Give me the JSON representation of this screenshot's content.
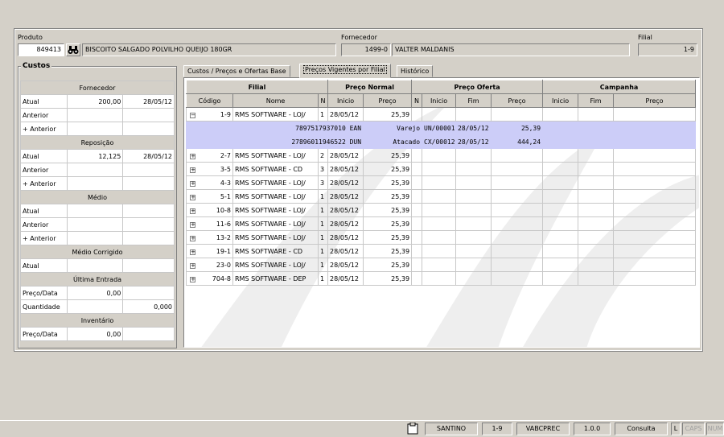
{
  "header": {
    "produto_label": "Produto",
    "produto_codigo": "849413",
    "produto_nome": "BISCOITO SALGADO POLVILHO QUEIJO 180GR",
    "fornecedor_label": "Fornecedor",
    "fornecedor_codigo": "1499-0",
    "fornecedor_nome": "VALTER MALDANIS",
    "filial_label": "Filial",
    "filial_value": "1-9"
  },
  "custos": {
    "title": "Custos",
    "sections": [
      {
        "title": "Fornecedor",
        "rows": [
          {
            "label": "Atual",
            "value": "200,00",
            "date": "28/05/12"
          },
          {
            "label": "Anterior",
            "value": "",
            "date": ""
          },
          {
            "label": "+ Anterior",
            "value": "",
            "date": ""
          }
        ]
      },
      {
        "title": "Reposição",
        "rows": [
          {
            "label": "Atual",
            "value": "12,125",
            "date": "28/05/12"
          },
          {
            "label": "Anterior",
            "value": "",
            "date": ""
          },
          {
            "label": "+ Anterior",
            "value": "",
            "date": ""
          }
        ]
      },
      {
        "title": "Médio",
        "rows": [
          {
            "label": "Atual",
            "value": "",
            "date": ""
          },
          {
            "label": "Anterior",
            "value": "",
            "date": ""
          },
          {
            "label": "+ Anterior",
            "value": "",
            "date": ""
          }
        ]
      },
      {
        "title": "Médio Corrigido",
        "rows": [
          {
            "label": "Atual",
            "value": "",
            "date": ""
          }
        ]
      },
      {
        "title": "Última Entrada",
        "rows": [
          {
            "label": "Preço/Data",
            "value": "0,00",
            "date": ""
          },
          {
            "label": "Quantidade",
            "value": "",
            "date": "0,000"
          }
        ]
      },
      {
        "title": "Inventário",
        "rows": [
          {
            "label": "Preço/Data",
            "value": "0,00",
            "date": ""
          }
        ]
      }
    ]
  },
  "tabs": [
    {
      "label": "Custos / Preços e Ofertas Base",
      "active": false
    },
    {
      "label": "Preços Vigentes por Filial",
      "active": true
    },
    {
      "label": "Histórico",
      "active": false
    }
  ],
  "grid": {
    "groups": [
      "Filial",
      "Preço Normal",
      "Preço Oferta",
      "Campanha"
    ],
    "columns": [
      "Código",
      "Nome",
      "N",
      "Inicio",
      "Preço",
      "N",
      "Inicio",
      "Fim",
      "Preço",
      "Inicio",
      "Fim",
      "Preço"
    ],
    "rows": [
      {
        "expander": "−",
        "codigo": "1-9",
        "nome": "RMS SOFTWARE - LOJ/",
        "n": "1",
        "inicio": "28/05/12",
        "preco": "25,39",
        "subrows": [
          {
            "ean": "7897517937010 EAN",
            "tipo": "Varejo",
            "emb": "UN/00001",
            "data": "28/05/12",
            "preco": "25,39"
          },
          {
            "ean": "27896011946522 DUN",
            "tipo": "Atacado",
            "emb": "CX/00012",
            "data": "28/05/12",
            "preco": "444,24"
          }
        ]
      },
      {
        "expander": "+",
        "codigo": "2-7",
        "nome": "RMS SOFTWARE - LOJ/",
        "n": "2",
        "inicio": "28/05/12",
        "preco": "25,39"
      },
      {
        "expander": "+",
        "codigo": "3-5",
        "nome": "RMS SOFTWARE - CD",
        "n": "3",
        "inicio": "28/05/12",
        "preco": "25,39"
      },
      {
        "expander": "+",
        "codigo": "4-3",
        "nome": "RMS SOFTWARE - LOJ/",
        "n": "3",
        "inicio": "28/05/12",
        "preco": "25,39"
      },
      {
        "expander": "+",
        "codigo": "5-1",
        "nome": "RMS SOFTWARE - LOJ/",
        "n": "1",
        "inicio": "28/05/12",
        "preco": "25,39"
      },
      {
        "expander": "+",
        "codigo": "10-8",
        "nome": "RMS SOFTWARE - LOJ/",
        "n": "1",
        "inicio": "28/05/12",
        "preco": "25,39"
      },
      {
        "expander": "+",
        "codigo": "11-6",
        "nome": "RMS SOFTWARE - LOJ/",
        "n": "1",
        "inicio": "28/05/12",
        "preco": "25,39"
      },
      {
        "expander": "+",
        "codigo": "13-2",
        "nome": "RMS SOFTWARE - LOJ/",
        "n": "1",
        "inicio": "28/05/12",
        "preco": "25,39"
      },
      {
        "expander": "+",
        "codigo": "19-1",
        "nome": "RMS SOFTWARE - CD",
        "n": "1",
        "inicio": "28/05/12",
        "preco": "25,39"
      },
      {
        "expander": "+",
        "codigo": "23-0",
        "nome": "RMS SOFTWARE - LOJ/",
        "n": "1",
        "inicio": "28/05/12",
        "preco": "25,39"
      },
      {
        "expander": "+",
        "codigo": "704-8",
        "nome": "RMS SOFTWARE - DEP",
        "n": "1",
        "inicio": "28/05/12",
        "preco": "25,39"
      }
    ]
  },
  "statusbar": {
    "user": "SANTINO",
    "filial": "1-9",
    "program": "VABCPREC",
    "version": "1.0.0",
    "mode": "Consulta",
    "l": "L",
    "caps": "CAPS",
    "num": "NUM"
  }
}
